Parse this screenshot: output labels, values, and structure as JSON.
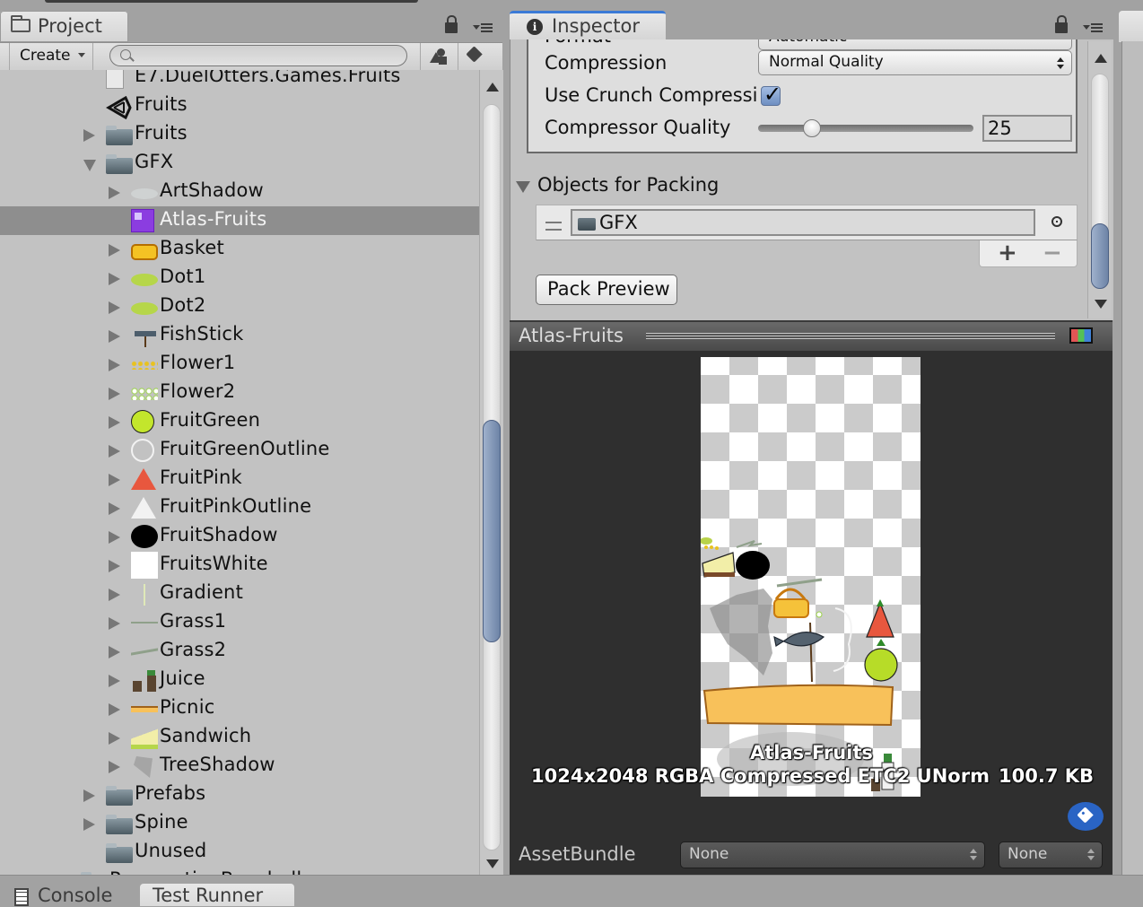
{
  "project_panel": {
    "tab_label": "Project",
    "toolbar": {
      "create_label": "Create",
      "search_placeholder": ""
    },
    "tree": [
      {
        "label": "E7.DuelOtters.Games.Fruits",
        "icon": "assembly-definition-icon",
        "indent": 2,
        "arrow": "none"
      },
      {
        "label": "Fruits",
        "icon": "unity-scene-icon",
        "indent": 2,
        "arrow": "none"
      },
      {
        "label": "Fruits",
        "icon": "folder-icon",
        "indent": 2,
        "arrow": "collapsed"
      },
      {
        "label": "GFX",
        "icon": "folder-icon",
        "indent": 2,
        "arrow": "expanded"
      },
      {
        "label": "ArtShadow",
        "icon": "sprite-artshadow-icon",
        "indent": 3,
        "arrow": "collapsed"
      },
      {
        "label": "Atlas-Fruits",
        "icon": "sprite-atlas-icon",
        "indent": 3,
        "arrow": "none",
        "selected": true
      },
      {
        "label": "Basket",
        "icon": "sprite-basket-icon",
        "indent": 3,
        "arrow": "collapsed"
      },
      {
        "label": "Dot1",
        "icon": "sprite-dot-icon",
        "indent": 3,
        "arrow": "collapsed"
      },
      {
        "label": "Dot2",
        "icon": "sprite-dot-icon",
        "indent": 3,
        "arrow": "collapsed"
      },
      {
        "label": "FishStick",
        "icon": "sprite-fishstick-icon",
        "indent": 3,
        "arrow": "collapsed"
      },
      {
        "label": "Flower1",
        "icon": "sprite-flower1-icon",
        "indent": 3,
        "arrow": "collapsed"
      },
      {
        "label": "Flower2",
        "icon": "sprite-flower2-icon",
        "indent": 3,
        "arrow": "collapsed"
      },
      {
        "label": "FruitGreen",
        "icon": "sprite-fruitgreen-icon",
        "indent": 3,
        "arrow": "collapsed"
      },
      {
        "label": "FruitGreenOutline",
        "icon": "sprite-fruitgreenoutline-icon",
        "indent": 3,
        "arrow": "collapsed"
      },
      {
        "label": "FruitPink",
        "icon": "sprite-fruitpink-icon",
        "indent": 3,
        "arrow": "collapsed"
      },
      {
        "label": "FruitPinkOutline",
        "icon": "sprite-fruitpinkoutline-icon",
        "indent": 3,
        "arrow": "collapsed"
      },
      {
        "label": "FruitShadow",
        "icon": "sprite-fruitshadow-icon",
        "indent": 3,
        "arrow": "collapsed"
      },
      {
        "label": "FruitsWhite",
        "icon": "sprite-fruitswhite-icon",
        "indent": 3,
        "arrow": "collapsed"
      },
      {
        "label": "Gradient",
        "icon": "sprite-gradient-icon",
        "indent": 3,
        "arrow": "collapsed"
      },
      {
        "label": "Grass1",
        "icon": "sprite-grass1-icon",
        "indent": 3,
        "arrow": "collapsed"
      },
      {
        "label": "Grass2",
        "icon": "sprite-grass2-icon",
        "indent": 3,
        "arrow": "collapsed"
      },
      {
        "label": "Juice",
        "icon": "sprite-juice-icon",
        "indent": 3,
        "arrow": "collapsed"
      },
      {
        "label": "Picnic",
        "icon": "sprite-picnic-icon",
        "indent": 3,
        "arrow": "collapsed"
      },
      {
        "label": "Sandwich",
        "icon": "sprite-sandwich-icon",
        "indent": 3,
        "arrow": "collapsed"
      },
      {
        "label": "TreeShadow",
        "icon": "sprite-treeshadow-icon",
        "indent": 3,
        "arrow": "collapsed"
      },
      {
        "label": "Prefabs",
        "icon": "folder-icon",
        "indent": 2,
        "arrow": "collapsed"
      },
      {
        "label": "Spine",
        "icon": "folder-icon",
        "indent": 2,
        "arrow": "collapsed"
      },
      {
        "label": "Unused",
        "icon": "folder-icon",
        "indent": 2,
        "arrow": "none"
      },
      {
        "label": "PerspectiveBaseball",
        "icon": "folder-icon",
        "indent": 1,
        "arrow": "collapsed"
      }
    ],
    "scroll_position": 0.55
  },
  "bottom_tabs": {
    "console_label": "Console",
    "test_runner_label": "Test Runner"
  },
  "inspector": {
    "tab_label": "Inspector",
    "format_label": "Format",
    "format_value": "Automatic",
    "compression_label": "Compression",
    "compression_value": "Normal Quality",
    "crunch_label": "Use Crunch Compressi",
    "crunch_checked": true,
    "compressor_quality_label": "Compressor Quality",
    "compressor_quality_value": "25",
    "compressor_quality_fraction": 0.25,
    "objects_for_packing_label": "Objects for Packing",
    "packing_objects": [
      {
        "label": "GFX",
        "icon": "folder-icon"
      }
    ],
    "add_label": "+",
    "remove_label": "−",
    "pack_preview_label": "Pack Preview",
    "scroll_position": 0.9
  },
  "preview": {
    "title": "Atlas-Fruits",
    "asset_name": "Atlas-Fruits",
    "info": "1024x2048 RGBA Compressed ETC2 UNorm",
    "size": "100.7 KB",
    "asset_bundle_label": "AssetBundle",
    "asset_bundle_name": "None",
    "asset_bundle_variant": "None"
  },
  "colors": {
    "selection": "#8e8e8e",
    "accent_tab": "#3b7ad6",
    "scroll_thumb": "#7f94b8",
    "preview_bg": "#2f2f2f",
    "label_button": "#2a64c4"
  }
}
